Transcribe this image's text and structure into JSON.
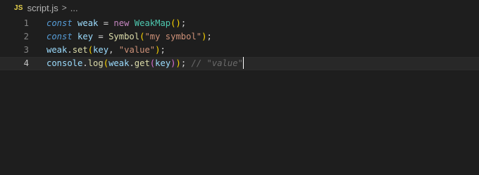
{
  "breadcrumb": {
    "badge": "JS",
    "file": "script.js",
    "chevron": ">",
    "more": "..."
  },
  "editor": {
    "current_line": 4,
    "lines": [
      {
        "number": "1",
        "tokens": [
          {
            "text": "const",
            "type": "kw-storage"
          },
          {
            "text": " ",
            "type": "op"
          },
          {
            "text": "weak",
            "type": "var"
          },
          {
            "text": " = ",
            "type": "op"
          },
          {
            "text": "new",
            "type": "kw-new"
          },
          {
            "text": " ",
            "type": "op"
          },
          {
            "text": "WeakMap",
            "type": "cls"
          },
          {
            "text": "()",
            "type": "paren1"
          },
          {
            "text": ";",
            "type": "punc"
          }
        ]
      },
      {
        "number": "2",
        "tokens": [
          {
            "text": "const",
            "type": "kw-storage"
          },
          {
            "text": " ",
            "type": "op"
          },
          {
            "text": "key",
            "type": "var"
          },
          {
            "text": " = ",
            "type": "op"
          },
          {
            "text": "Symbol",
            "type": "fn"
          },
          {
            "text": "(",
            "type": "paren1"
          },
          {
            "text": "\"my symbol\"",
            "type": "str"
          },
          {
            "text": ")",
            "type": "paren1"
          },
          {
            "text": ";",
            "type": "punc"
          }
        ]
      },
      {
        "number": "3",
        "tokens": [
          {
            "text": "weak",
            "type": "var"
          },
          {
            "text": ".",
            "type": "punc"
          },
          {
            "text": "set",
            "type": "fn"
          },
          {
            "text": "(",
            "type": "paren1"
          },
          {
            "text": "key",
            "type": "var"
          },
          {
            "text": ", ",
            "type": "punc"
          },
          {
            "text": "\"value\"",
            "type": "str"
          },
          {
            "text": ")",
            "type": "paren1"
          },
          {
            "text": ";",
            "type": "punc"
          }
        ]
      },
      {
        "number": "4",
        "tokens": [
          {
            "text": "console",
            "type": "var"
          },
          {
            "text": ".",
            "type": "punc"
          },
          {
            "text": "log",
            "type": "fn"
          },
          {
            "text": "(",
            "type": "paren1"
          },
          {
            "text": "weak",
            "type": "var"
          },
          {
            "text": ".",
            "type": "punc"
          },
          {
            "text": "get",
            "type": "fn"
          },
          {
            "text": "(",
            "type": "paren2"
          },
          {
            "text": "key",
            "type": "var"
          },
          {
            "text": ")",
            "type": "paren2"
          },
          {
            "text": ")",
            "type": "paren1"
          },
          {
            "text": ";",
            "type": "punc"
          },
          {
            "text": " ",
            "type": "op"
          },
          {
            "text": "// \"value\"",
            "type": "cmt"
          }
        ]
      }
    ]
  },
  "colors": {
    "background": "#1e1e1e",
    "js_badge": "#e8d44d"
  }
}
